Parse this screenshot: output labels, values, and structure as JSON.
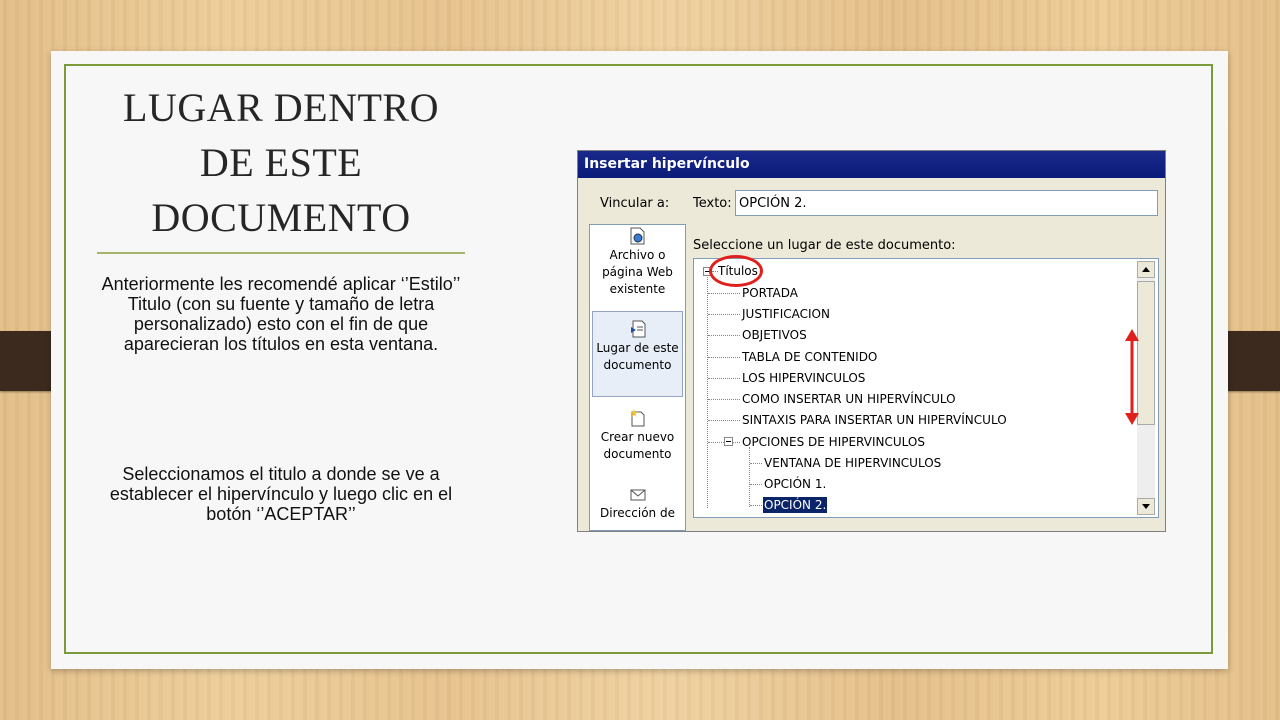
{
  "slide": {
    "title_lines": [
      "LUGAR DENTRO",
      "DE ESTE",
      "DOCUMENTO"
    ],
    "paragraph1": "Anteriormente les recomendé aplicar ‘’Estilo’’ Titulo (con su fuente y tamaño de letra personalizado) esto con el fin de que aparecieran los títulos en esta ventana.",
    "paragraph2": "Seleccionamos el titulo a donde se ve a establecer el hipervínculo y luego clic en el botón ‘’ACEPTAR’’"
  },
  "dialog": {
    "title": "Insertar hipervínculo",
    "vincular_label": "Vincular a:",
    "texto_label": "Texto:",
    "texto_value": "OPCIÓN 2.",
    "select_label": "Seleccione un lugar de este documento:",
    "link_targets": [
      {
        "label_lines": [
          "Archivo o",
          "página Web",
          "existente"
        ],
        "icon": "file-web-icon"
      },
      {
        "label_lines": [
          "Lugar de este",
          "documento"
        ],
        "icon": "document-place-icon"
      },
      {
        "label_lines": [
          "Crear nuevo",
          "documento"
        ],
        "icon": "new-document-icon"
      },
      {
        "label_lines": [
          "Dirección de"
        ],
        "icon": "email-icon"
      }
    ],
    "tree": {
      "root": "Títulos",
      "items": [
        "PORTADA",
        "JUSTIFICACION",
        "OBJETIVOS",
        "TABLA DE CONTENIDO",
        "LOS HIPERVINCULOS",
        "COMO INSERTAR UN HIPERVÍNCULO",
        "SINTAXIS PARA INSERTAR UN HIPERVÍNCULO",
        "OPCIONES DE HIPERVINCULOS"
      ],
      "subitems": [
        "VENTANA DE HIPERVINCULOS",
        "OPCIÓN 1.",
        "OPCIÓN 2."
      ],
      "selected": "OPCIÓN 2."
    }
  },
  "colors": {
    "frame": "#7b9a3a",
    "annotation": "#e0201c",
    "titlebar": "#0a1a78",
    "selection": "#0a246a"
  }
}
